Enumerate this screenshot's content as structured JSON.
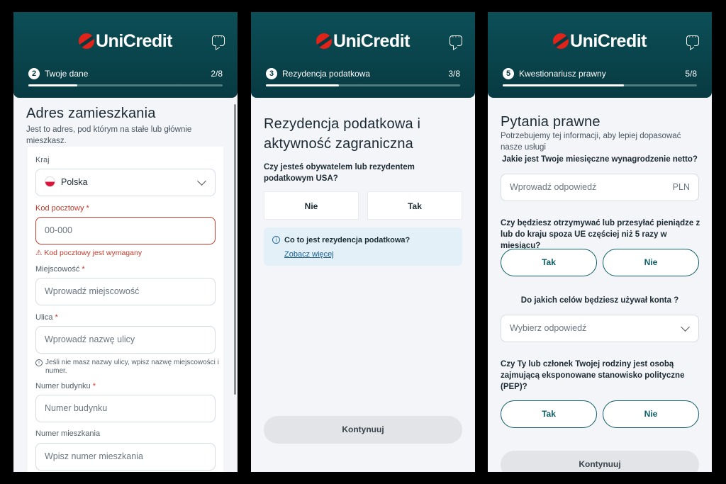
{
  "screens": [
    {
      "logo": "UniCredit",
      "step": {
        "number": "2",
        "label": "Twoje dane",
        "count": "2/8",
        "progress": 0.25
      },
      "title": "Adres zamieszkania",
      "subtitle": "Jest to adres, pod którym na stałe lub głównie mieszkasz.",
      "country": {
        "label": "Kraj",
        "value": "Polska"
      },
      "postal": {
        "label": "Kod pocztowy",
        "required": "*",
        "placeholder": "00-000",
        "error": "Kod pocztowy jest wymagany"
      },
      "city": {
        "label": "Miejscowość",
        "required": "*",
        "placeholder": "Wprowadź miejscowość"
      },
      "street": {
        "label": "Ulica",
        "required": "*",
        "placeholder": "Wprowadź nazwę ulicy",
        "hint": "Jeśli nie masz nazwy ulicy, wpisz nazwę miejscowości i numer."
      },
      "building": {
        "label": "Numer budynku",
        "required": "*",
        "placeholder": "Numer budynku"
      },
      "apartment": {
        "label": "Numer mieszkania",
        "placeholder": "Wpisz numer mieszkania"
      }
    },
    {
      "logo": "UniCredit",
      "step": {
        "number": "3",
        "label": "Rezydencja podatkowa",
        "count": "3/8",
        "progress": 0.375
      },
      "title_line1": "Rezydencja podatkowa i",
      "title_line2": "aktywność zagraniczna",
      "question": "Czy jesteś obywatelem lub rezydentem podatkowym USA?",
      "option_no": "Nie",
      "option_yes": "Tak",
      "info_title": "Co to jest rezydencja podatkowa?",
      "info_link": "Zobacz więcej",
      "continue": "Kontynuuj"
    },
    {
      "logo": "UniCredit",
      "step": {
        "number": "5",
        "label": "Kwestionariusz prawny",
        "count": "5/8",
        "progress": 0.625
      },
      "title": "Pytania prawne",
      "subtitle": "Potrzebujemy tej informacji, aby lepiej dopasować nasze usługi",
      "q1": "Jakie jest Twoje miesięczne wynagrodzenie netto?",
      "q1_placeholder": "Wprowadź odpowiedź",
      "q1_unit": "PLN",
      "q2": "Czy będziesz otrzymywać lub przesyłać pieniądze z lub do kraju spoza UE częściej niż 5 razy w miesiącu?",
      "q2_yes": "Tak",
      "q2_no": "Nie",
      "q3": "Do jakich celów będziesz używał konta ?",
      "q3_placeholder": "Wybierz odpowiedź",
      "q4": "Czy Ty lub członek Twojej rodziny jest osobą zajmującą eksponowane stanowisko polityczne (PEP)?",
      "q4_yes": "Tak",
      "q4_no": "Nie",
      "continue": "Kontynuuj"
    }
  ],
  "colors": {
    "header": "#083a42",
    "accent": "#0d5d66",
    "error": "#c0392b",
    "brand_red": "#e2231a"
  }
}
